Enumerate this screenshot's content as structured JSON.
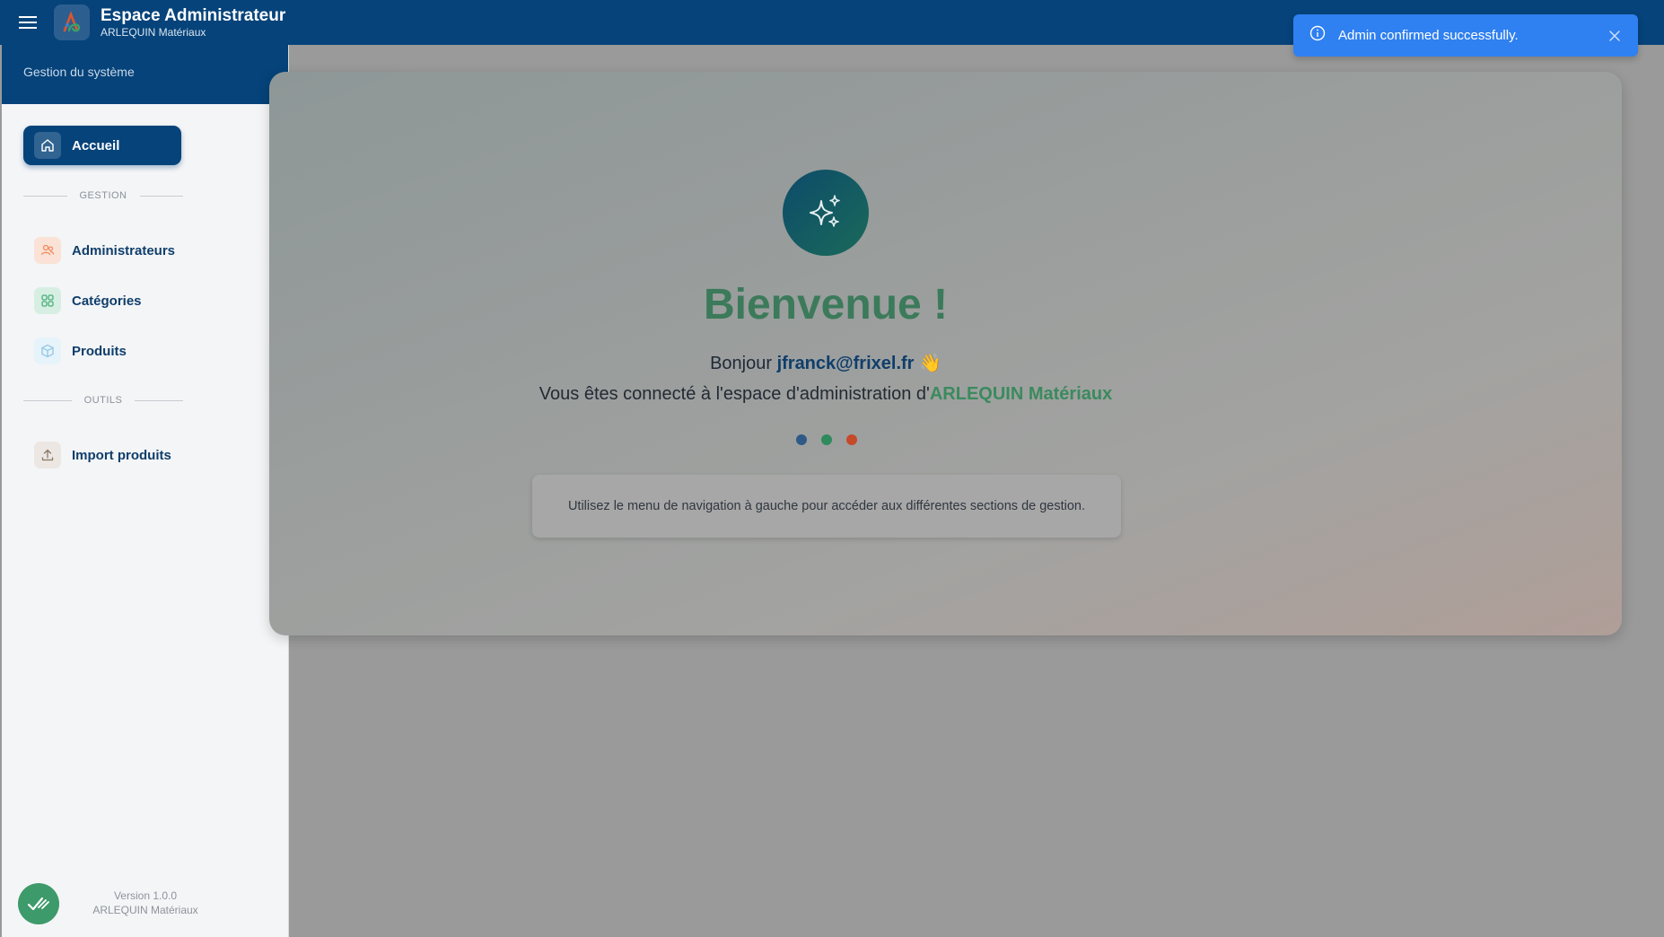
{
  "header": {
    "title": "Espace Administrateur",
    "subtitle": "ARLEQUIN Matériaux",
    "menu_icon": "hamburger-menu-icon",
    "logo_icon": "arlequin-logo-icon"
  },
  "sidebar": {
    "heading": "Gestion du système",
    "active_item": {
      "label": "Accueil",
      "icon": "home-icon"
    },
    "sections": [
      {
        "label": "GESTION",
        "items": [
          {
            "label": "Administrateurs",
            "icon": "users-icon",
            "color": "#f08a5d"
          },
          {
            "label": "Catégories",
            "icon": "grid-icon",
            "color": "#4caf7d"
          },
          {
            "label": "Produits",
            "icon": "box-icon",
            "color": "#8ac4e0"
          }
        ]
      },
      {
        "label": "OUTILS",
        "items": [
          {
            "label": "Import produits",
            "icon": "upload-icon",
            "color": "#8a7a6a"
          }
        ]
      }
    ],
    "footer": {
      "version": "Version 1.0.0",
      "company": "ARLEQUIN Matériaux",
      "badge_icon": "check-badge-icon"
    }
  },
  "main": {
    "icon": "sparkles-icon",
    "title": "Bienvenue !",
    "greeting_prefix": "Bonjour ",
    "email": "jfranck@frixel.fr",
    "greeting_emoji": "👋",
    "connected_prefix": "Vous êtes connecté à l'espace d'administration d'",
    "company": "ARLEQUIN Matériaux",
    "dots": [
      "#2f5a86",
      "#2f8a5e",
      "#c44a2a"
    ],
    "info": "Utilisez le menu de navigation à gauche pour accéder aux différentes sections de gestion."
  },
  "toast": {
    "message": "Admin confirmed successfully.",
    "icon": "info-icon",
    "close_icon": "close-icon",
    "color": "#2f80f0"
  },
  "colors": {
    "primary": "#05437a",
    "accent_green": "#3b8a5e"
  }
}
